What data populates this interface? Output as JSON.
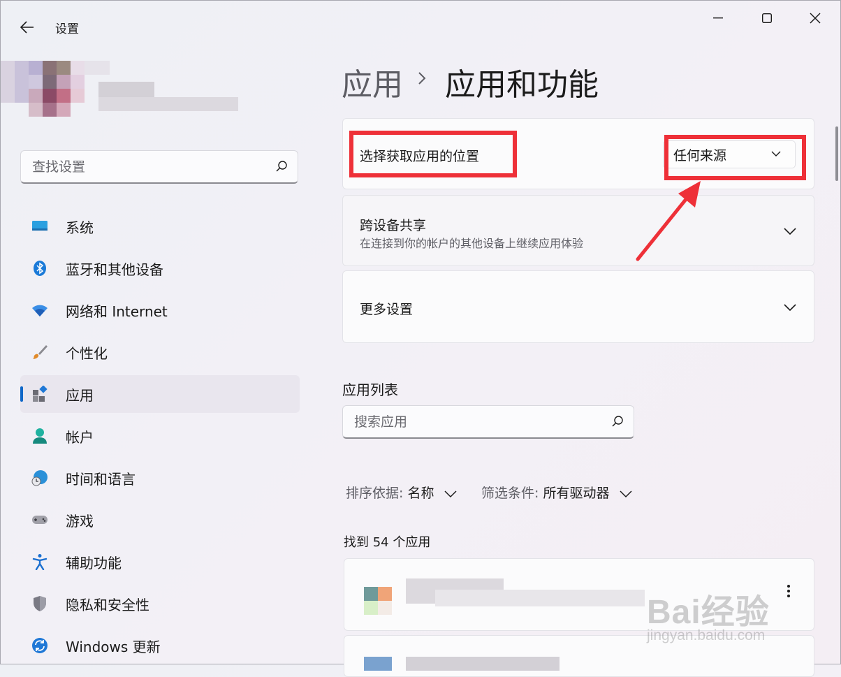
{
  "window": {
    "title": "设置",
    "controls": [
      "minimize",
      "maximize",
      "close"
    ]
  },
  "sidebar": {
    "search_placeholder": "查找设置",
    "items": [
      {
        "label": "系统",
        "icon": "monitor-icon"
      },
      {
        "label": "蓝牙和其他设备",
        "icon": "bluetooth-icon"
      },
      {
        "label": "网络和 Internet",
        "icon": "wifi-icon"
      },
      {
        "label": "个性化",
        "icon": "brush-icon"
      },
      {
        "label": "应用",
        "icon": "apps-icon",
        "active": true
      },
      {
        "label": "帐户",
        "icon": "account-icon"
      },
      {
        "label": "时间和语言",
        "icon": "globe-clock-icon"
      },
      {
        "label": "游戏",
        "icon": "gamepad-icon"
      },
      {
        "label": "辅助功能",
        "icon": "accessibility-icon"
      },
      {
        "label": "隐私和安全性",
        "icon": "shield-icon"
      },
      {
        "label": "Windows 更新",
        "icon": "update-icon"
      }
    ]
  },
  "main": {
    "breadcrumb_parent": "应用",
    "breadcrumb_current": "应用和功能",
    "choose_location": {
      "label": "选择获取应用的位置",
      "selected": "任何来源"
    },
    "cross_device": {
      "title": "跨设备共享",
      "subtitle": "在连接到你的帐户的其他设备上继续应用体验"
    },
    "more_settings": {
      "title": "更多设置"
    },
    "app_list": {
      "heading": "应用列表",
      "search_placeholder": "搜索应用",
      "sort_key": "排序依据:",
      "sort_value": "名称",
      "filter_key": "筛选条件:",
      "filter_value": "所有驱动器",
      "found": "找到 54 个应用"
    }
  },
  "watermark": {
    "brand": "Bai经验",
    "url": "jingyan.baidu.com"
  },
  "colors": {
    "accent": "#0f67c8",
    "annotation": "#ee3038"
  }
}
